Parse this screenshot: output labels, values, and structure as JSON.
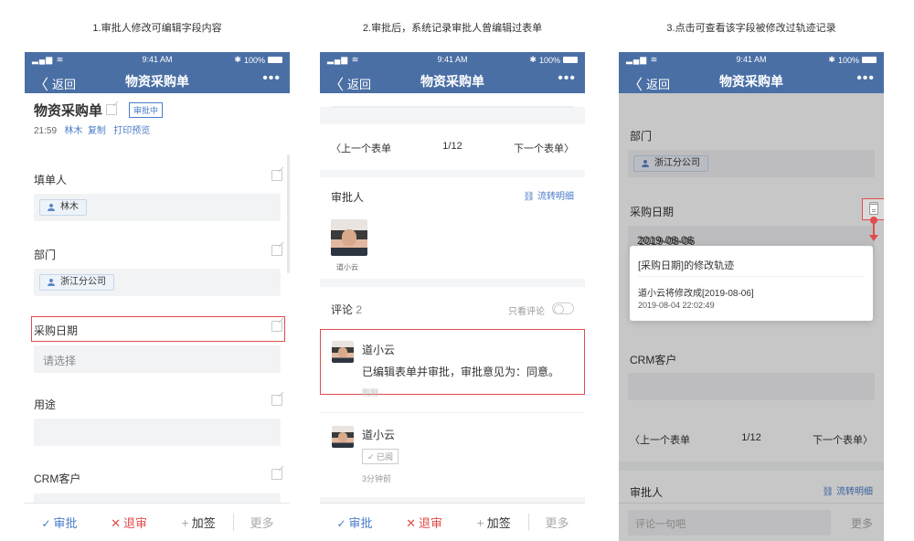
{
  "captions": [
    "1.审批人修改可编辑字段内容",
    "2.审批后，系统记录审批人曾编辑过表单",
    "3.点击可查看该字段被修改过轨迹记录"
  ],
  "status_bar": {
    "time": "9:41 AM",
    "battery": "100%",
    "battery_icon": "✱"
  },
  "nav": {
    "back": "返回",
    "title": "物资采购单",
    "more": "•••"
  },
  "phone1": {
    "form_title": "物资采购单",
    "status_badge": "审批中",
    "meta_time": "21:59",
    "meta_user": "林木",
    "meta_copy": "复制",
    "meta_print": "打印预览",
    "filler_label": "填单人",
    "filler_value": "林木",
    "dept_label": "部门",
    "dept_value": "浙江分公司",
    "date_label": "采购日期",
    "date_placeholder": "请选择",
    "usage_label": "用途",
    "crm_label": "CRM客户"
  },
  "bottom_bar": {
    "approve": "审批",
    "reject": "退审",
    "sign": "加签",
    "more": "更多"
  },
  "phone2": {
    "prev": "〈上一个表单",
    "page": "1/12",
    "next": "下一个表单〉",
    "approver_label": "审批人",
    "flow_detail": "流转明细",
    "approver_name": "道小云",
    "comments_label": "评论",
    "comments_count": "2",
    "only_comments": "只看评论",
    "comment1_name": "道小云",
    "comment1_text": "已编辑表单并审批，审批意见为：同意。",
    "comment1_time": "刚刚",
    "comment2_name": "道小云",
    "comment2_badge": "✓ 已阅",
    "comment2_time": "3分钟前"
  },
  "phone3": {
    "dept_label": "部门",
    "dept_value": "浙江分公司",
    "date_label": "采购日期",
    "date_value": "2019-08-06",
    "popup_title": "[采购日期]的修改轨迹",
    "popup_line1": "道小云将修改成[2019-08-06]",
    "popup_line2": "2019-08-04 22:02:49",
    "crm_label": "CRM客户",
    "prev": "〈上一个表单",
    "page": "1/12",
    "next": "下一个表单〉",
    "approver_label": "审批人",
    "flow_detail": "流转明细",
    "comment_placeholder": "评论一句吧",
    "more": "更多"
  },
  "colors": {
    "nav": "#4a6fa5",
    "accent": "#4a7cc9",
    "danger": "#e24c4c"
  }
}
